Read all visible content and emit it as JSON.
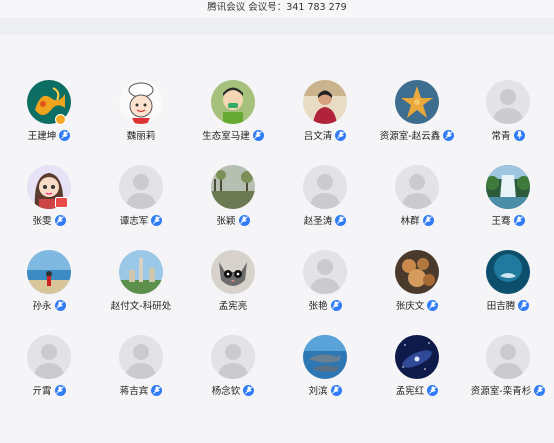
{
  "window": {
    "title": "腾讯会议 会议号：341 783 279"
  },
  "participants": [
    {
      "name": "王建坤",
      "avatar": "photo-goldfish",
      "mic": "muted",
      "badge": "host"
    },
    {
      "name": "魏丽莉",
      "avatar": "cartoon-chef",
      "mic": "none",
      "badge": ""
    },
    {
      "name": "生态室马建",
      "avatar": "cartoon-person",
      "mic": "muted",
      "badge": ""
    },
    {
      "name": "吕文清",
      "avatar": "photo-woman",
      "mic": "muted",
      "badge": ""
    },
    {
      "name": "资源室-赵云鑫",
      "avatar": "photo-starfish",
      "mic": "muted",
      "badge": ""
    },
    {
      "name": "常青",
      "avatar": "default",
      "mic": "active",
      "badge": ""
    },
    {
      "name": "张雯",
      "avatar": "cartoon-girl",
      "mic": "muted",
      "badge": "screen"
    },
    {
      "name": "谭志军",
      "avatar": "default",
      "mic": "muted",
      "badge": ""
    },
    {
      "name": "张颖",
      "avatar": "photo-landscape",
      "mic": "muted",
      "badge": ""
    },
    {
      "name": "赵圣涛",
      "avatar": "default",
      "mic": "muted",
      "badge": ""
    },
    {
      "name": "林群",
      "avatar": "default",
      "mic": "muted",
      "badge": ""
    },
    {
      "name": "王骞",
      "avatar": "photo-waterfall",
      "mic": "muted",
      "badge": ""
    },
    {
      "name": "孙永",
      "avatar": "photo-beach",
      "mic": "muted",
      "badge": ""
    },
    {
      "name": "赵付文-科研处",
      "avatar": "photo-tower",
      "mic": "none",
      "badge": ""
    },
    {
      "name": "孟宪亮",
      "avatar": "photo-cat",
      "mic": "none",
      "badge": ""
    },
    {
      "name": "张艳",
      "avatar": "default",
      "mic": "muted",
      "badge": ""
    },
    {
      "name": "张庆文",
      "avatar": "photo-food",
      "mic": "muted",
      "badge": ""
    },
    {
      "name": "田吉腾",
      "avatar": "photo-ocean",
      "mic": "muted",
      "badge": ""
    },
    {
      "name": "亓霄",
      "avatar": "default",
      "mic": "muted",
      "badge": ""
    },
    {
      "name": "蒋吉宾",
      "avatar": "default",
      "mic": "muted",
      "badge": ""
    },
    {
      "name": "杨念钦",
      "avatar": "default",
      "mic": "muted",
      "badge": ""
    },
    {
      "name": "刘滨",
      "avatar": "photo-dolphins",
      "mic": "muted",
      "badge": ""
    },
    {
      "name": "孟宪红",
      "avatar": "photo-galaxy",
      "mic": "muted",
      "badge": ""
    },
    {
      "name": "资源室-栾青杉",
      "avatar": "default",
      "mic": "muted",
      "badge": ""
    }
  ],
  "colors": {
    "mic_blue": "#2f7cf6",
    "background": "#f5f5f7",
    "default_avatar": "#e3e3e6"
  }
}
